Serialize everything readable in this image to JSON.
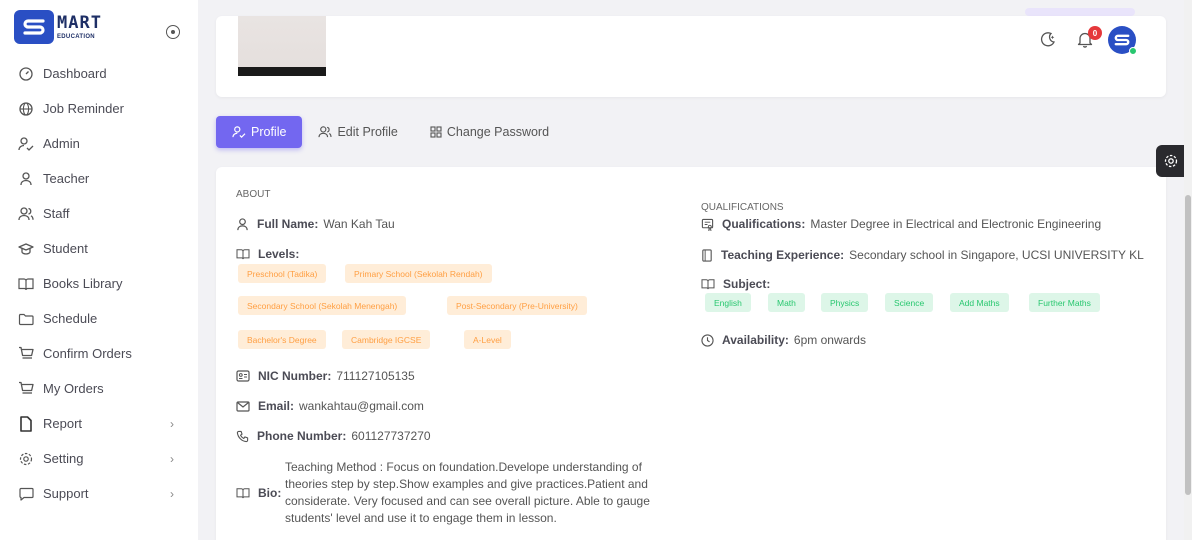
{
  "app": {
    "logo_main": "MART",
    "logo_sub": "EDUCATION"
  },
  "sidebar": {
    "items": [
      {
        "label": "Dashboard",
        "icon": "gauge-icon",
        "has_submenu": false
      },
      {
        "label": "Job Reminder",
        "icon": "globe-icon",
        "has_submenu": false
      },
      {
        "label": "Admin",
        "icon": "user-check-icon",
        "has_submenu": false
      },
      {
        "label": "Teacher",
        "icon": "user-icon",
        "has_submenu": false
      },
      {
        "label": "Staff",
        "icon": "users-icon",
        "has_submenu": false
      },
      {
        "label": "Student",
        "icon": "graduation-cap-icon",
        "has_submenu": false
      },
      {
        "label": "Books Library",
        "icon": "book-open-icon",
        "has_submenu": false
      },
      {
        "label": "Schedule",
        "icon": "folder-icon",
        "has_submenu": false
      },
      {
        "label": "Confirm Orders",
        "icon": "cart-icon",
        "has_submenu": false
      },
      {
        "label": "My Orders",
        "icon": "cart-icon",
        "has_submenu": false
      },
      {
        "label": "Report",
        "icon": "file-icon",
        "has_submenu": true
      },
      {
        "label": "Setting",
        "icon": "gear-icon",
        "has_submenu": true
      },
      {
        "label": "Support",
        "icon": "chat-icon",
        "has_submenu": true
      }
    ]
  },
  "header": {
    "notification_count": "0"
  },
  "tabs": [
    {
      "label": "Profile",
      "active": true
    },
    {
      "label": "Edit Profile",
      "active": false
    },
    {
      "label": "Change Password",
      "active": false
    }
  ],
  "about": {
    "title": "ABOUT",
    "full_name_label": "Full Name:",
    "full_name": "Wan Kah Tau",
    "levels_label": "Levels:",
    "levels": [
      "Preschool (Tadika)",
      "Primary School (Sekolah Rendah)",
      "Secondary School (Sekolah Menengah)",
      "Post-Secondary (Pre-University)",
      "Bachelor's Degree",
      "Cambridge IGCSE",
      "A-Level"
    ],
    "nic_label": "NIC Number:",
    "nic": "711127105135",
    "email_label": "Email:",
    "email": "wankahtau@gmail.com",
    "phone_label": "Phone Number:",
    "phone": "601127737270",
    "bio_label": "Bio:",
    "bio": "Teaching Method : Focus on foundation.Develope understanding of theories step by step.Show examples and give practices.Patient and considerate. Very focused and can see overall picture. Able to gauge students' level and use it to engage them in lesson."
  },
  "qualifications": {
    "title": "QUALIFICATIONS",
    "qualifications_label": "Qualifications:",
    "qualifications": "Master Degree in Electrical and Electronic Engineering",
    "experience_label": "Teaching Experience:",
    "experience": "Secondary school in Singapore, UCSI UNIVERSITY KL",
    "subject_label": "Subject:",
    "subjects": [
      "English",
      "Math",
      "Physics",
      "Science",
      "Add Maths",
      "Further Maths"
    ],
    "availability_label": "Availability:",
    "availability": "6pm onwards"
  },
  "colors": {
    "accent": "#7367f0",
    "brand": "#2a4fc4",
    "chip_orange": "#ff9f43",
    "chip_green": "#28c76f",
    "badge": "#e5383b"
  }
}
